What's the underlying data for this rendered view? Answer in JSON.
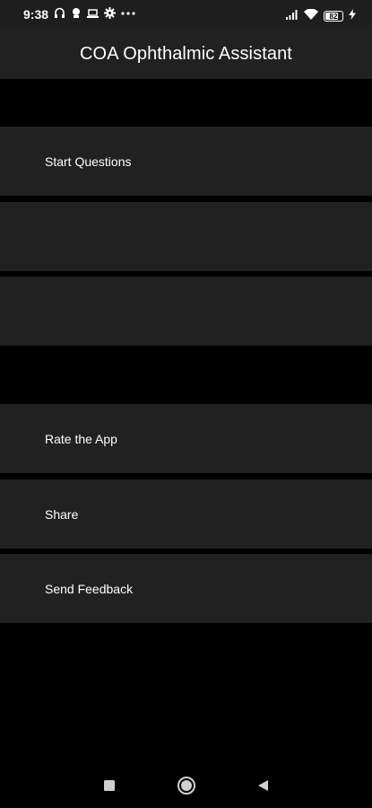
{
  "status_bar": {
    "time": "9:38",
    "battery_level": 82,
    "battery_text": "82",
    "left_icons": [
      "headset-icon",
      "notification-icon",
      "laptop-icon",
      "settings-icon",
      "more-dots-icon"
    ],
    "right_icons": [
      "signal-icon",
      "wifi-icon",
      "battery-icon",
      "charging-icon"
    ]
  },
  "app_bar": {
    "title": "COA Ophthalmic Assistant"
  },
  "menu": {
    "start_questions": "Start Questions",
    "rate_app": "Rate the App",
    "share": "Share",
    "send_feedback": "Send Feedback"
  },
  "nav_bar": {
    "icons": [
      "recents-square-icon",
      "home-circle-icon",
      "back-triangle-icon"
    ]
  },
  "colors": {
    "background": "#000000",
    "surface": "#212121",
    "text": "#ffffff"
  }
}
